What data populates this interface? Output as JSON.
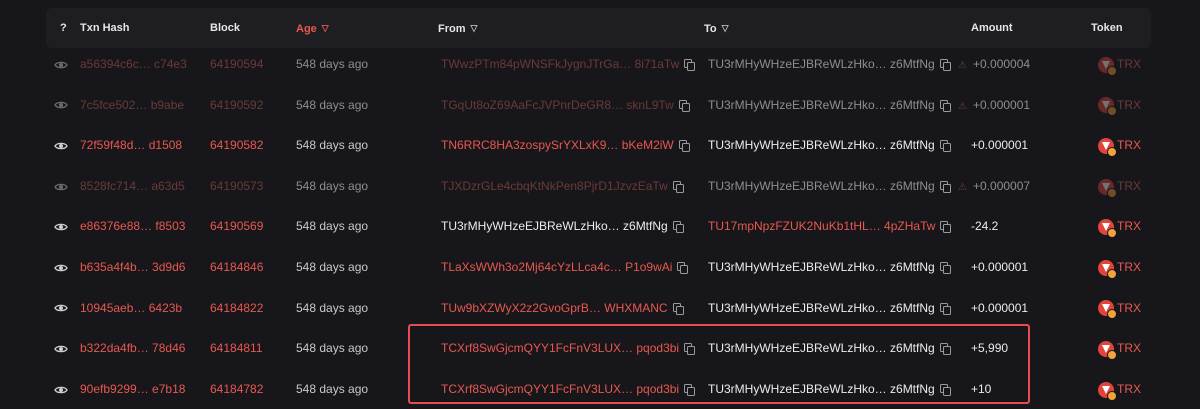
{
  "header": {
    "help": "?",
    "txn_hash": "Txn Hash",
    "block": "Block",
    "age": "Age",
    "from": "From",
    "to": "To",
    "amount": "Amount",
    "token": "Token"
  },
  "rows": [
    {
      "hash": "a56394c6c… c74e3",
      "block": "64190594",
      "age": "548 days ago",
      "from": "TWwzPTm84pWNSFkJygnJTrGa… 8i71aTw",
      "to": "TU3rMHyWHzeEJBReWLzHko… z6MtfNg",
      "amount": "+0.000004",
      "token": "TRX",
      "dim": true,
      "warn": true
    },
    {
      "hash": "7c5fce502… b9abe",
      "block": "64190592",
      "age": "548 days ago",
      "from": "TGqUt8oZ69AaFcJVPnrDeGR8… sknL9Tw",
      "to": "TU3rMHyWHzeEJBReWLzHko… z6MtfNg",
      "amount": "+0.000001",
      "token": "TRX",
      "dim": true,
      "warn": true
    },
    {
      "hash": "72f59f48d… d1508",
      "block": "64190582",
      "age": "548 days ago",
      "from": "TN6RRC8HA3zospySrYXLxK9… bKeM2iW",
      "to": "TU3rMHyWHzeEJBReWLzHko… z6MtfNg",
      "amount": "+0.000001",
      "token": "TRX",
      "dim": false,
      "warn": false
    },
    {
      "hash": "8528fc714… a63d5",
      "block": "64190573",
      "age": "548 days ago",
      "from": "TJXDzrGLe4cbqKtNkPen8PjrD1JzvzEaTw",
      "to": "TU3rMHyWHzeEJBReWLzHko… z6MtfNg",
      "amount": "+0.000007",
      "token": "TRX",
      "dim": true,
      "warn": true
    },
    {
      "hash": "e86376e88… f8503",
      "block": "64190569",
      "age": "548 days ago",
      "from": "TU3rMHyWHzeEJBReWLzHko… z6MtfNg",
      "to": "TU17mpNpzFZUK2NuKb1tHL… 4pZHaTw",
      "amount": "-24.2",
      "token": "TRX",
      "dim": false,
      "warn": false,
      "out": true
    },
    {
      "hash": "b635a4f4b… 3d9d6",
      "block": "64184846",
      "age": "548 days ago",
      "from": "TLaXsWWh3o2Mj64cYzLLca4c… P1o9wAi",
      "to": "TU3rMHyWHzeEJBReWLzHko… z6MtfNg",
      "amount": "+0.000001",
      "token": "TRX",
      "dim": false,
      "warn": false
    },
    {
      "hash": "10945aeb… 6423b",
      "block": "64184822",
      "age": "548 days ago",
      "from": "TUw9bXZWyX2z2GvoGprB… WHXMANC",
      "to": "TU3rMHyWHzeEJBReWLzHko… z6MtfNg",
      "amount": "+0.000001",
      "token": "TRX",
      "dim": false,
      "warn": false
    },
    {
      "hash": "b322da4fb… 78d46",
      "block": "64184811",
      "age": "548 days ago",
      "from": "TCXrf8SwGjcmQYY1FcFnV3LUX… pqod3bi",
      "to": "TU3rMHyWHzeEJBReWLzHko… z6MtfNg",
      "amount": "+5,990",
      "token": "TRX",
      "dim": false,
      "warn": false
    },
    {
      "hash": "90efb9299… e7b18",
      "block": "64184782",
      "age": "548 days ago",
      "from": "TCXrf8SwGjcmQYY1FcFnV3LUX… pqod3bi",
      "to": "TU3rMHyWHzeEJBReWLzHko… z6MtfNg",
      "amount": "+10",
      "token": "TRX",
      "dim": false,
      "warn": false
    }
  ],
  "colors": {
    "accent": "#e8584f",
    "background": "#17171b",
    "highlight": "#e64c52"
  }
}
